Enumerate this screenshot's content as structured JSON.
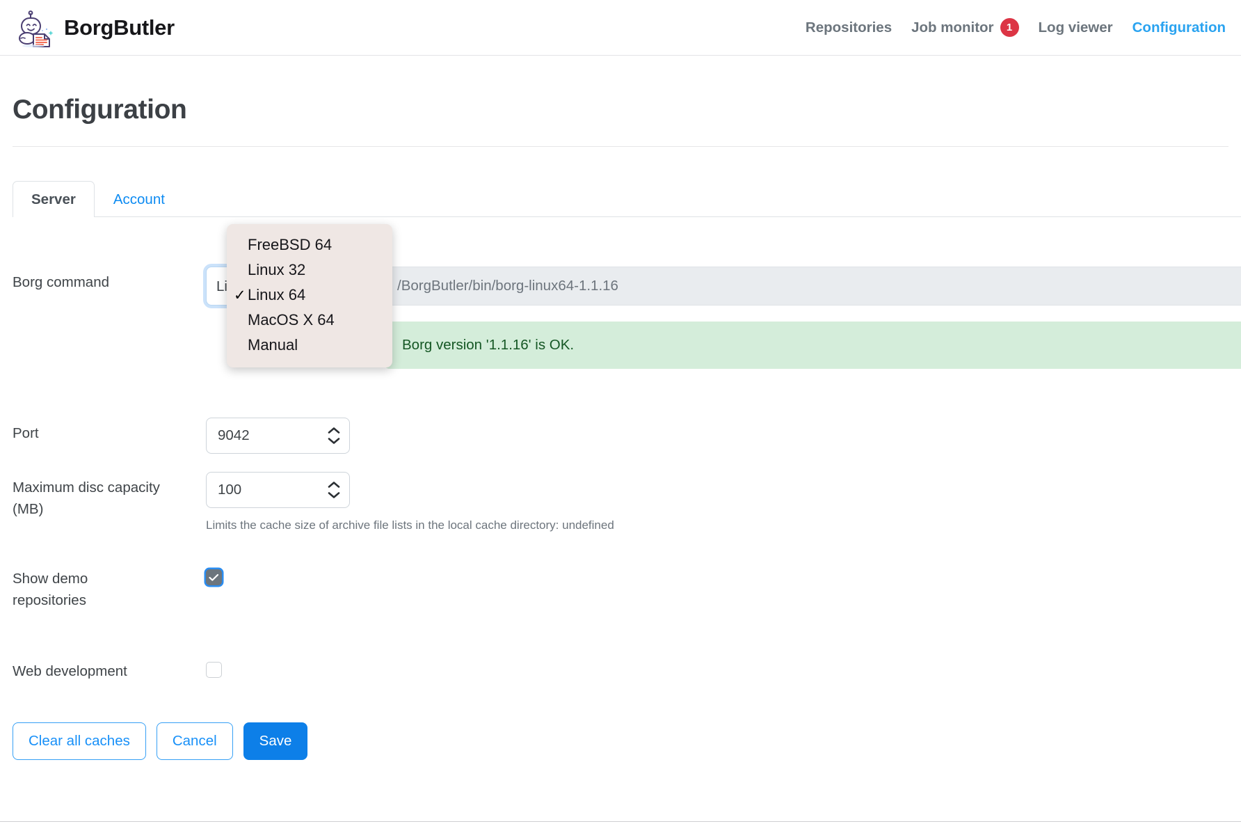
{
  "header": {
    "brand": "BorgButler",
    "logo_icon": "borgbutler-robot-logo",
    "nav": [
      {
        "label": "Repositories",
        "active": false,
        "badge": null
      },
      {
        "label": "Job monitor",
        "active": false,
        "badge": "1"
      },
      {
        "label": "Log viewer",
        "active": false,
        "badge": null
      },
      {
        "label": "Configuration",
        "active": true,
        "badge": null
      }
    ]
  },
  "page": {
    "title": "Configuration"
  },
  "tabs": [
    {
      "label": "Server",
      "active": true
    },
    {
      "label": "Account",
      "active": false
    }
  ],
  "form": {
    "borg_command": {
      "label": "Borg command",
      "select_value": "Linux 64",
      "path_value": "/BorgButler/bin/borg-linux64-1.1.16",
      "status_message": "Borg version '1.1.16' is OK.",
      "status_color": "#d4edda",
      "status_text_color": "#155724"
    },
    "port": {
      "label": "Port",
      "value": "9042",
      "stepper_up_icon": "chevron-up-icon",
      "stepper_down_icon": "chevron-down-icon"
    },
    "max_disc_capacity": {
      "label": "Maximum disc capacity (MB)",
      "label_line1": "Maximum disc capacity",
      "label_line2": "(MB)",
      "value": "100",
      "help": "Limits the cache size of archive file lists in the local cache directory: undefined"
    },
    "show_demo_repositories": {
      "label": "Show demo repositories",
      "label_line1": "Show demo",
      "label_line2": "repositories",
      "checked": true
    },
    "web_development": {
      "label": "Web development",
      "checked": false
    }
  },
  "buttons": {
    "clear_all_caches": "Clear all caches",
    "cancel": "Cancel",
    "save": "Save"
  },
  "dropdown": {
    "open": true,
    "selected": "Linux 64",
    "check_glyph": "✓",
    "options": [
      {
        "label": "FreeBSD 64",
        "selected": false
      },
      {
        "label": "Linux 32",
        "selected": false
      },
      {
        "label": "Linux 64",
        "selected": true
      },
      {
        "label": "MacOS X 64",
        "selected": false
      },
      {
        "label": "Manual",
        "selected": false
      }
    ]
  },
  "colors": {
    "accent": "#2aa3f0",
    "primary_button": "#0d7fe8",
    "badge": "#dc3545",
    "muted": "#6c757d",
    "dropdown_bg": "#efe7e4"
  }
}
